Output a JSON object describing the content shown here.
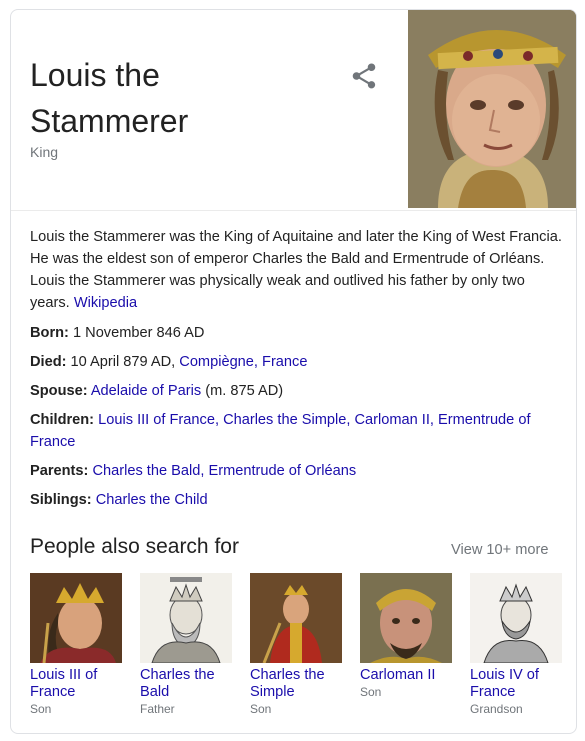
{
  "entity": {
    "title": "Louis the Stammerer",
    "subtitle": "King",
    "share_icon": "share-icon"
  },
  "description": {
    "text": "Louis the Stammerer was the King of Aquitaine and later the King of West Francia. He was the eldest son of emperor Charles the Bald and Ermentrude of Orléans. Louis the Stammerer was physically weak and outlived his father by only two years.",
    "source": "Wikipedia"
  },
  "facts": {
    "born": {
      "label": "Born:",
      "value": "1 November 846 AD"
    },
    "died": {
      "label": "Died:",
      "value": "10 April 879 AD,",
      "links": [
        "Compiègne, France"
      ]
    },
    "spouse": {
      "label": "Spouse:",
      "links": [
        "Adelaide of Paris"
      ],
      "value_after": "(m. 875 AD)"
    },
    "children": {
      "label": "Children:",
      "links": [
        "Louis III of France",
        "Charles the Simple",
        "Carloman II",
        "Ermentrude of France"
      ]
    },
    "parents": {
      "label": "Parents:",
      "links": [
        "Charles the Bald",
        "Ermentrude of Orléans"
      ]
    },
    "siblings": {
      "label": "Siblings:",
      "links": [
        "Charles the Child"
      ]
    }
  },
  "people_also_search": {
    "title": "People also search for",
    "view_more": "View 10+ more",
    "people": [
      {
        "name": "Louis III of France",
        "relation": "Son"
      },
      {
        "name": "Charles the Bald",
        "relation": "Father"
      },
      {
        "name": "Charles the Simple",
        "relation": "Son"
      },
      {
        "name": "Carloman II",
        "relation": "Son"
      },
      {
        "name": "Louis IV of France",
        "relation": "Grandson"
      }
    ]
  },
  "colors": {
    "link": "#1a0dab",
    "text": "#222222",
    "secondary": "#70757a",
    "border": "#dfe1e5"
  }
}
